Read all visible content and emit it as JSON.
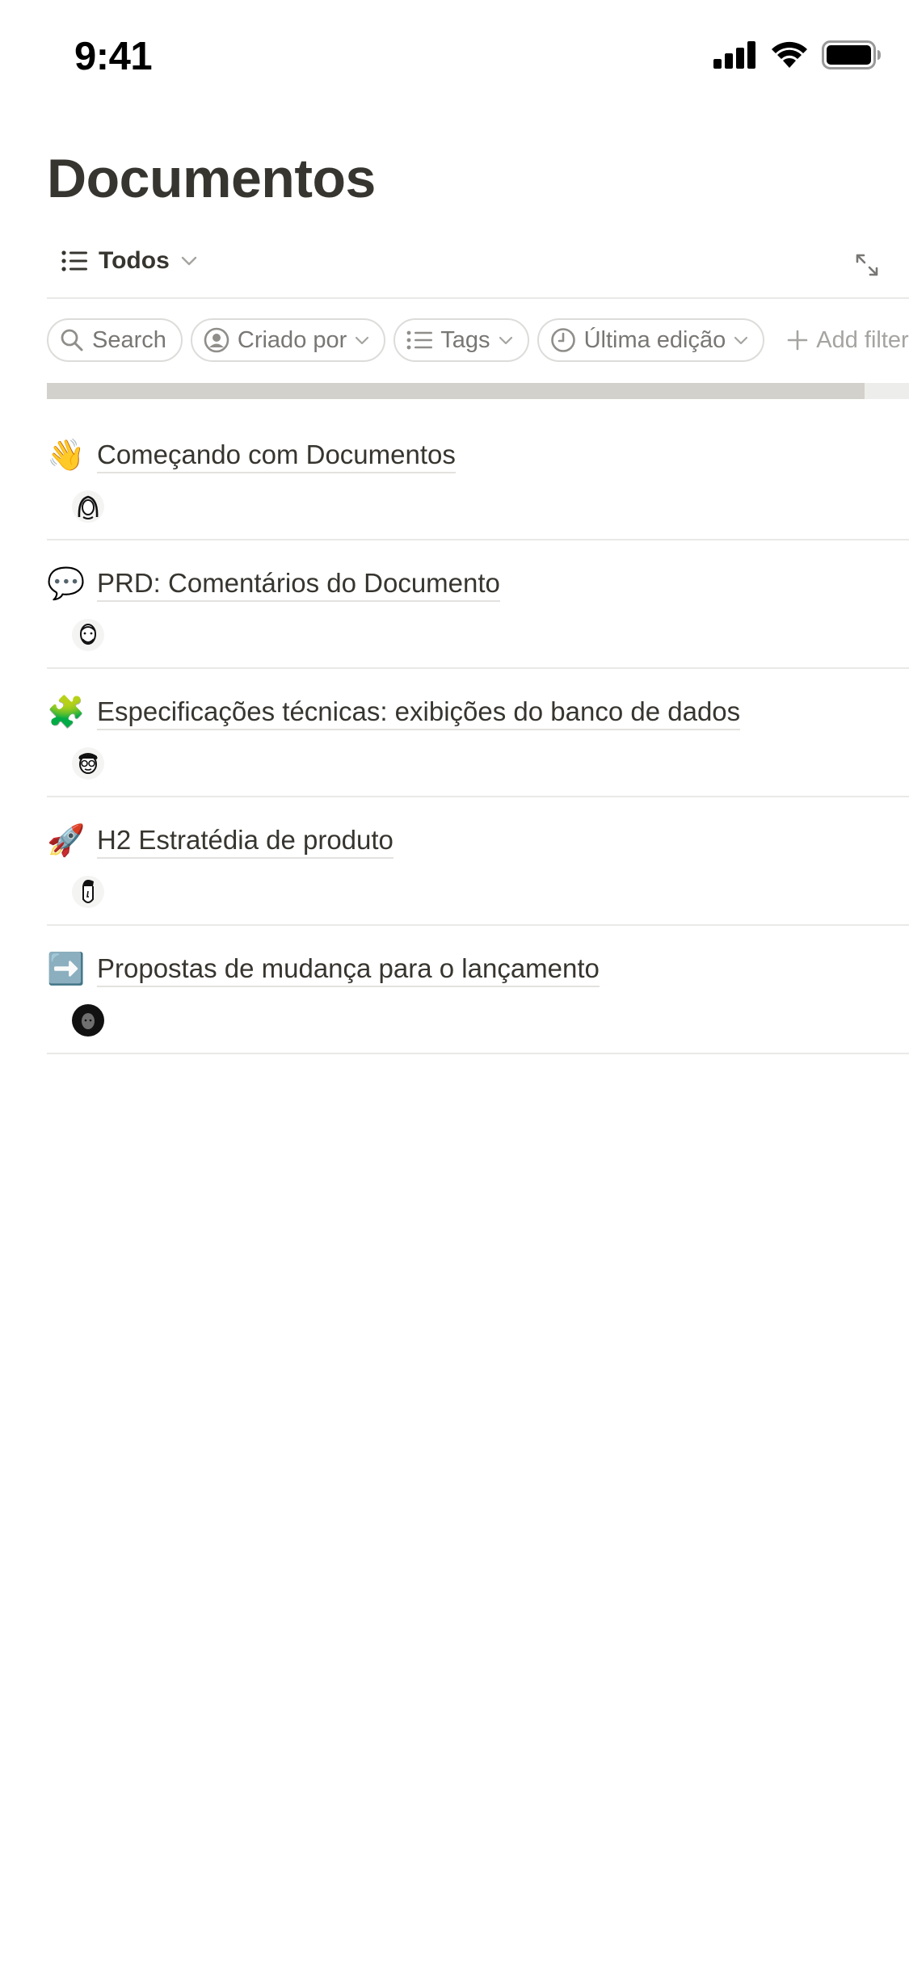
{
  "status_bar": {
    "time": "9:41"
  },
  "page": {
    "title": "Documentos"
  },
  "view": {
    "label": "Todos"
  },
  "filters": [
    {
      "label": "Search",
      "icon": "search-icon"
    },
    {
      "label": "Criado por",
      "icon": "person-icon"
    },
    {
      "label": "Tags",
      "icon": "list-icon"
    },
    {
      "label": "Última edição",
      "icon": "clock-icon"
    },
    {
      "label": "Add filter",
      "icon": "plus-icon"
    }
  ],
  "documents": [
    {
      "emoji": "👋",
      "icon": "waving-hand-icon",
      "title": "Começando com Documentos",
      "avatar": "avatar-woman-icon"
    },
    {
      "emoji": "💬",
      "icon": "speech-bubble-icon",
      "title": "PRD: Comentários do Documento",
      "avatar": "avatar-bearded-man-icon"
    },
    {
      "emoji": "🧩",
      "icon": "puzzle-piece-icon",
      "title": "Especificações técnicas: exibições do banco de dados",
      "avatar": "avatar-glasses-man-icon"
    },
    {
      "emoji": "🚀",
      "icon": "rocket-icon",
      "title": "H2 Estratédia de produto",
      "avatar": "avatar-tall-hair-man-icon"
    },
    {
      "emoji": "➡️",
      "icon": "right-arrow-icon",
      "title": "Propostas de mudança para o lançamento",
      "avatar": "avatar-dark-woman-icon"
    }
  ]
}
